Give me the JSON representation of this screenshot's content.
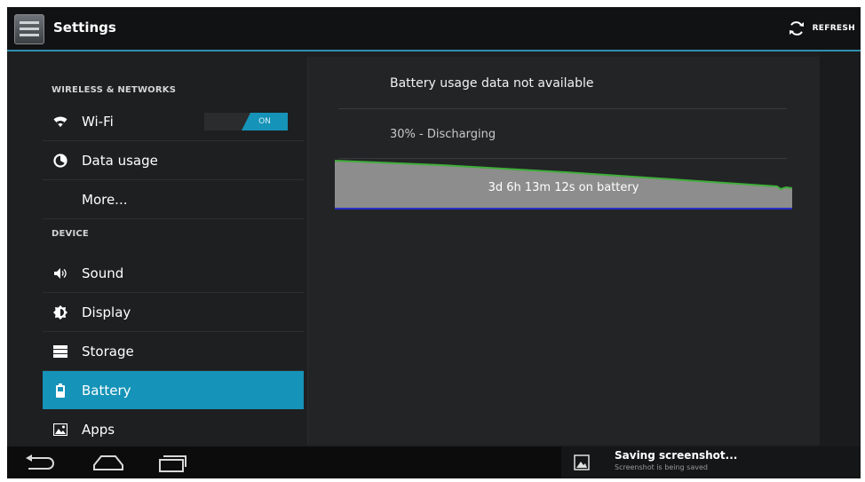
{
  "action_bar": {
    "title": "Settings",
    "refresh_label": "REFRESH"
  },
  "sidebar": {
    "sections": [
      {
        "header": "WIRELESS & NETWORKS"
      },
      {
        "header": "DEVICE"
      }
    ],
    "items": [
      {
        "label": "Wi-Fi",
        "icon": "wifi-icon",
        "toggle": "ON"
      },
      {
        "label": "Data usage",
        "icon": "data-usage-icon"
      },
      {
        "label": "More..."
      },
      {
        "label": "Sound",
        "icon": "speaker-icon"
      },
      {
        "label": "Display",
        "icon": "brightness-icon"
      },
      {
        "label": "Storage",
        "icon": "storage-icon"
      },
      {
        "label": "Battery",
        "icon": "battery-icon",
        "selected": true
      },
      {
        "label": "Apps",
        "icon": "apps-icon"
      }
    ]
  },
  "battery": {
    "usage_message": "Battery usage data not available",
    "status": "30% - Discharging",
    "graph_label": "3d 6h 13m 12s on battery"
  },
  "notification": {
    "title": "Saving screenshot...",
    "subtitle": "Screenshot is being saved"
  },
  "colors": {
    "accent": "#1593b8",
    "graph_line": "#3fae3a",
    "graph_fill": "#8d8d8d",
    "graph_base": "#2a2ec8"
  }
}
